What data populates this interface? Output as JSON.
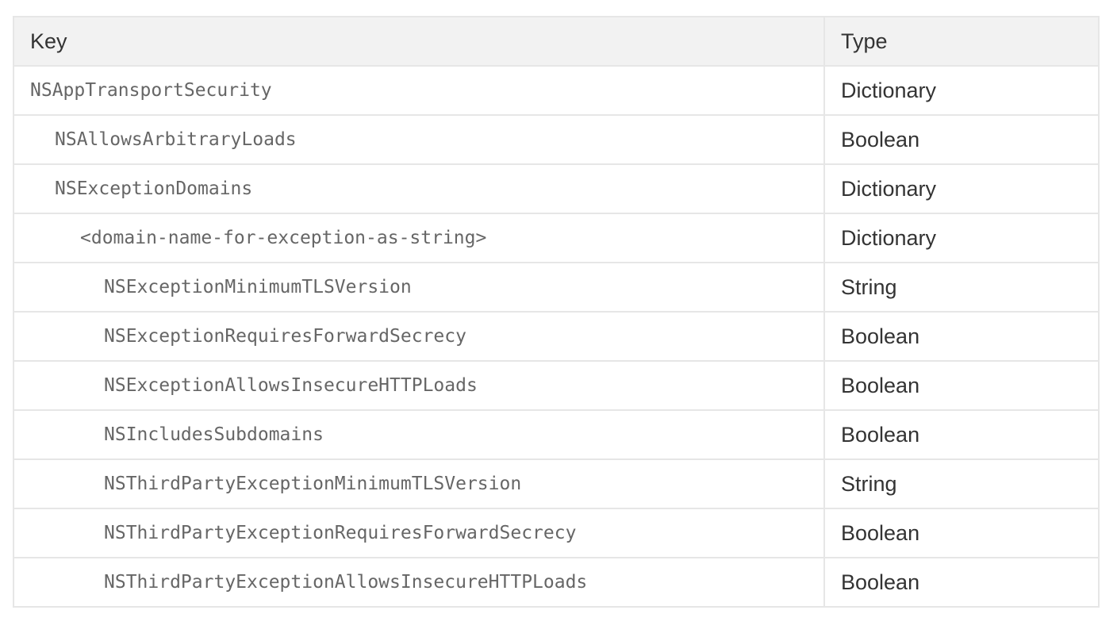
{
  "table": {
    "headers": {
      "key": "Key",
      "type": "Type"
    },
    "rows": [
      {
        "key": "NSAppTransportSecurity",
        "type": "Dictionary",
        "depth": 0
      },
      {
        "key": "NSAllowsArbitraryLoads",
        "type": "Boolean",
        "depth": 1
      },
      {
        "key": "NSExceptionDomains",
        "type": "Dictionary",
        "depth": 1
      },
      {
        "key": "<domain-name-for-exception-as-string>",
        "type": "Dictionary",
        "depth": 2
      },
      {
        "key": "NSExceptionMinimumTLSVersion",
        "type": "String",
        "depth": 3
      },
      {
        "key": "NSExceptionRequiresForwardSecrecy",
        "type": "Boolean",
        "depth": 3
      },
      {
        "key": "NSExceptionAllowsInsecureHTTPLoads",
        "type": "Boolean",
        "depth": 3
      },
      {
        "key": "NSIncludesSubdomains",
        "type": "Boolean",
        "depth": 3
      },
      {
        "key": "NSThirdPartyExceptionMinimumTLSVersion",
        "type": "String",
        "depth": 3
      },
      {
        "key": "NSThirdPartyExceptionRequiresForwardSecrecy",
        "type": "Boolean",
        "depth": 3
      },
      {
        "key": "NSThirdPartyExceptionAllowsInsecureHTTPLoads",
        "type": "Boolean",
        "depth": 3
      }
    ]
  }
}
